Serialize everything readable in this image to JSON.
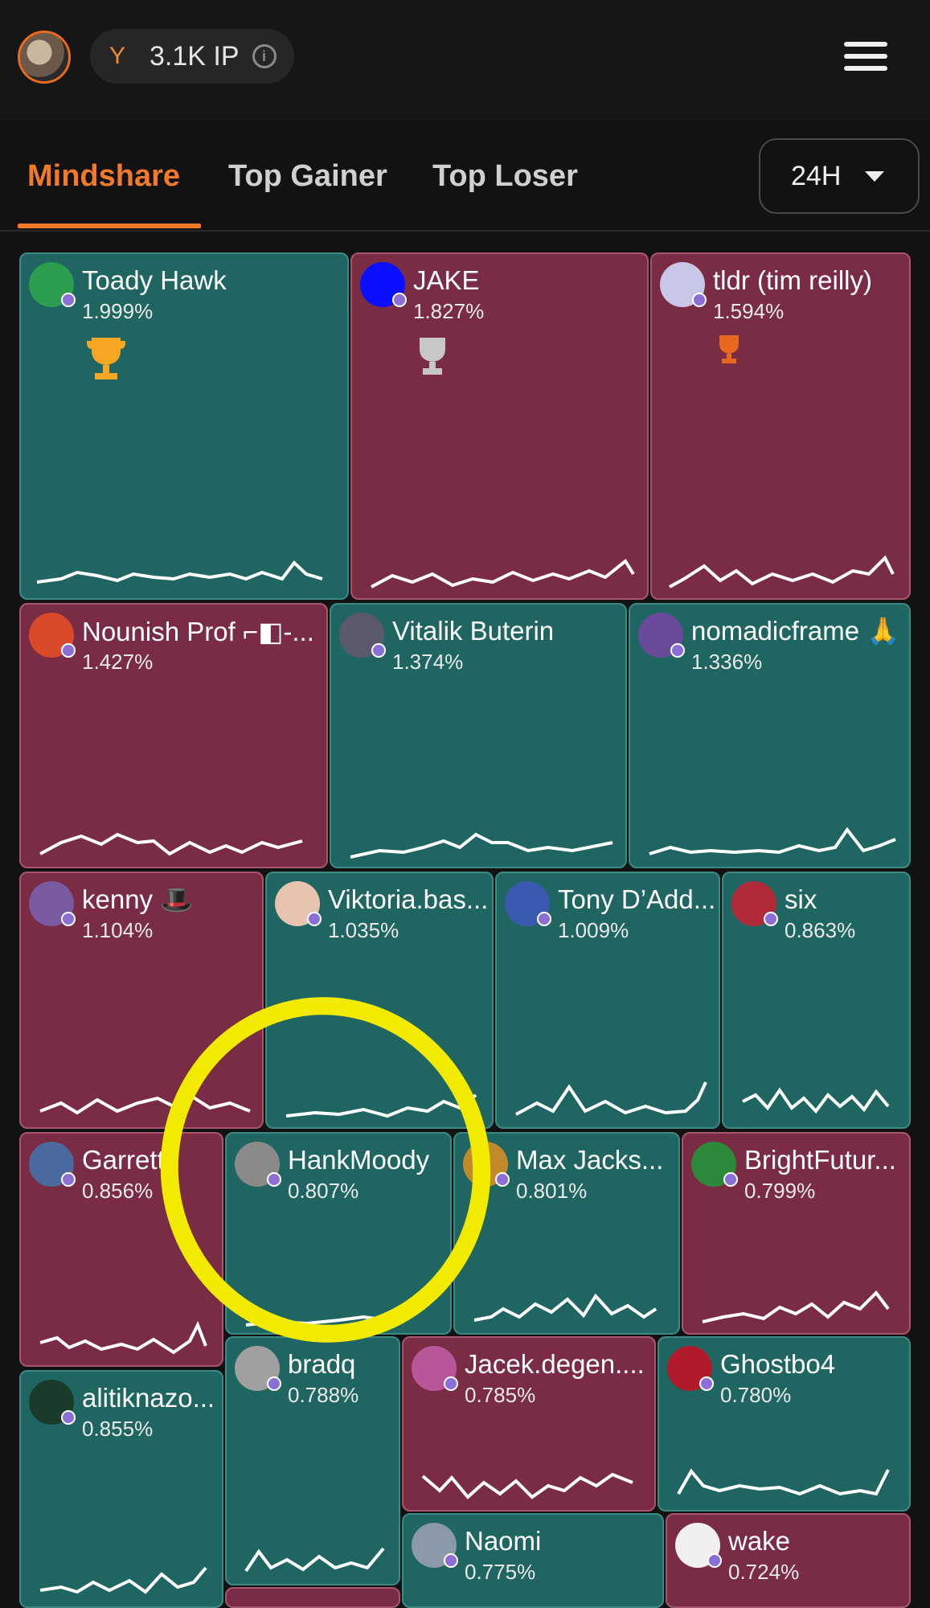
{
  "header": {
    "ip_value": "3.1K IP",
    "ip_icon": "y-logo-icon",
    "info_icon": "i"
  },
  "tabs": [
    {
      "label": "Mindshare",
      "active": true
    },
    {
      "label": "Top Gainer",
      "active": false
    },
    {
      "label": "Top Loser",
      "active": false
    }
  ],
  "period": {
    "value": "24H"
  },
  "colors": {
    "accent": "#f07a2a",
    "tile_up": "#1f6662",
    "tile_down": "#7a2c45",
    "highlight": "#f2ea00"
  },
  "tiles": [
    {
      "name": "Toady Hawk",
      "pct": "1.999%",
      "trend": "up",
      "trophy": "gold"
    },
    {
      "name": "JAKE",
      "pct": "1.827%",
      "trend": "down",
      "trophy": "silver"
    },
    {
      "name": "tldr (tim reilly)",
      "pct": "1.594%",
      "trend": "down",
      "trophy": "bronze"
    },
    {
      "name": "Nounish Prof ⌐◧-...",
      "pct": "1.427%",
      "trend": "down"
    },
    {
      "name": "Vitalik Buterin",
      "pct": "1.374%",
      "trend": "up"
    },
    {
      "name": "nomadicframe 🙏",
      "pct": "1.336%",
      "trend": "up"
    },
    {
      "name": "kenny 🎩",
      "pct": "1.104%",
      "trend": "down"
    },
    {
      "name": "Viktoria.bas...",
      "pct": "1.035%",
      "trend": "up"
    },
    {
      "name": "Tony D’Add...",
      "pct": "1.009%",
      "trend": "up"
    },
    {
      "name": "six",
      "pct": "0.863%",
      "trend": "up"
    },
    {
      "name": "Garrett",
      "pct": "0.856%",
      "trend": "down"
    },
    {
      "name": "HankMoody",
      "pct": "0.807%",
      "trend": "up"
    },
    {
      "name": "Max Jacks...",
      "pct": "0.801%",
      "trend": "up"
    },
    {
      "name": "BrightFutur...",
      "pct": "0.799%",
      "trend": "down"
    },
    {
      "name": "alitiknazo...",
      "pct": "0.855%",
      "trend": "up"
    },
    {
      "name": "bradq",
      "pct": "0.788%",
      "trend": "up"
    },
    {
      "name": "Jacek.degen....",
      "pct": "0.785%",
      "trend": "down"
    },
    {
      "name": "Ghostbo4",
      "pct": "0.780%",
      "trend": "up"
    },
    {
      "name": "Naomi",
      "pct": "0.775%",
      "trend": "up"
    },
    {
      "name": "wake",
      "pct": "0.724%",
      "trend": "down"
    }
  ]
}
